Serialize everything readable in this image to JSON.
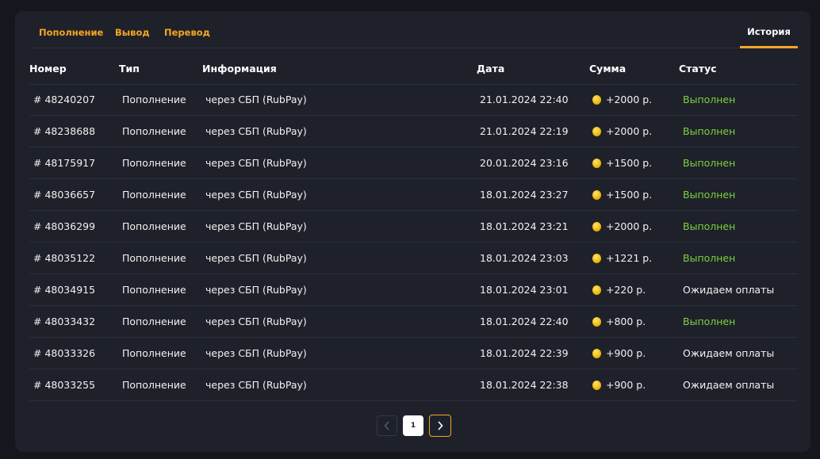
{
  "tabs": {
    "deposit": "Пополнение",
    "withdraw": "Вывод",
    "transfer": "Перевод",
    "history": "История"
  },
  "table": {
    "columns": {
      "number": "Номер",
      "type": "Тип",
      "info": "Информация",
      "date": "Дата",
      "sum": "Сумма",
      "status": "Статус"
    },
    "rows": [
      {
        "number": "# 48240207",
        "type": "Пополнение",
        "info": "через СБП (RubPay)",
        "date": "21.01.2024 22:40",
        "sum": "+2000 р.",
        "status": "Выполнен",
        "status_kind": "ok"
      },
      {
        "number": "# 48238688",
        "type": "Пополнение",
        "info": "через СБП (RubPay)",
        "date": "21.01.2024 22:19",
        "sum": "+2000 р.",
        "status": "Выполнен",
        "status_kind": "ok"
      },
      {
        "number": "# 48175917",
        "type": "Пополнение",
        "info": "через СБП (RubPay)",
        "date": "20.01.2024 23:16",
        "sum": "+1500 р.",
        "status": "Выполнен",
        "status_kind": "ok"
      },
      {
        "number": "# 48036657",
        "type": "Пополнение",
        "info": "через СБП (RubPay)",
        "date": "18.01.2024 23:27",
        "sum": "+1500 р.",
        "status": "Выполнен",
        "status_kind": "ok"
      },
      {
        "number": "# 48036299",
        "type": "Пополнение",
        "info": "через СБП (RubPay)",
        "date": "18.01.2024 23:21",
        "sum": "+2000 р.",
        "status": "Выполнен",
        "status_kind": "ok"
      },
      {
        "number": "# 48035122",
        "type": "Пополнение",
        "info": "через СБП (RubPay)",
        "date": "18.01.2024 23:03",
        "sum": "+1221 р.",
        "status": "Выполнен",
        "status_kind": "ok"
      },
      {
        "number": "# 48034915",
        "type": "Пополнение",
        "info": "через СБП (RubPay)",
        "date": "18.01.2024 23:01",
        "sum": "+220 р.",
        "status": "Ожидаем оплаты",
        "status_kind": "wait"
      },
      {
        "number": "# 48033432",
        "type": "Пополнение",
        "info": "через СБП (RubPay)",
        "date": "18.01.2024 22:40",
        "sum": "+800 р.",
        "status": "Выполнен",
        "status_kind": "ok"
      },
      {
        "number": "# 48033326",
        "type": "Пополнение",
        "info": "через СБП (RubPay)",
        "date": "18.01.2024 22:39",
        "sum": "+900 р.",
        "status": "Ожидаем оплаты",
        "status_kind": "wait"
      },
      {
        "number": "# 48033255",
        "type": "Пополнение",
        "info": "через СБП (RubPay)",
        "date": "18.01.2024 22:38",
        "sum": "+900 р.",
        "status": "Ожидаем оплаты",
        "status_kind": "wait"
      }
    ]
  },
  "pagination": {
    "current_page": "1",
    "prev_icon": "chevron-left-icon",
    "next_icon": "chevron-right-icon"
  },
  "colors": {
    "accent": "#f5a623",
    "success": "#7dd13f",
    "background": "#15171f",
    "panel": "#1e212a"
  }
}
